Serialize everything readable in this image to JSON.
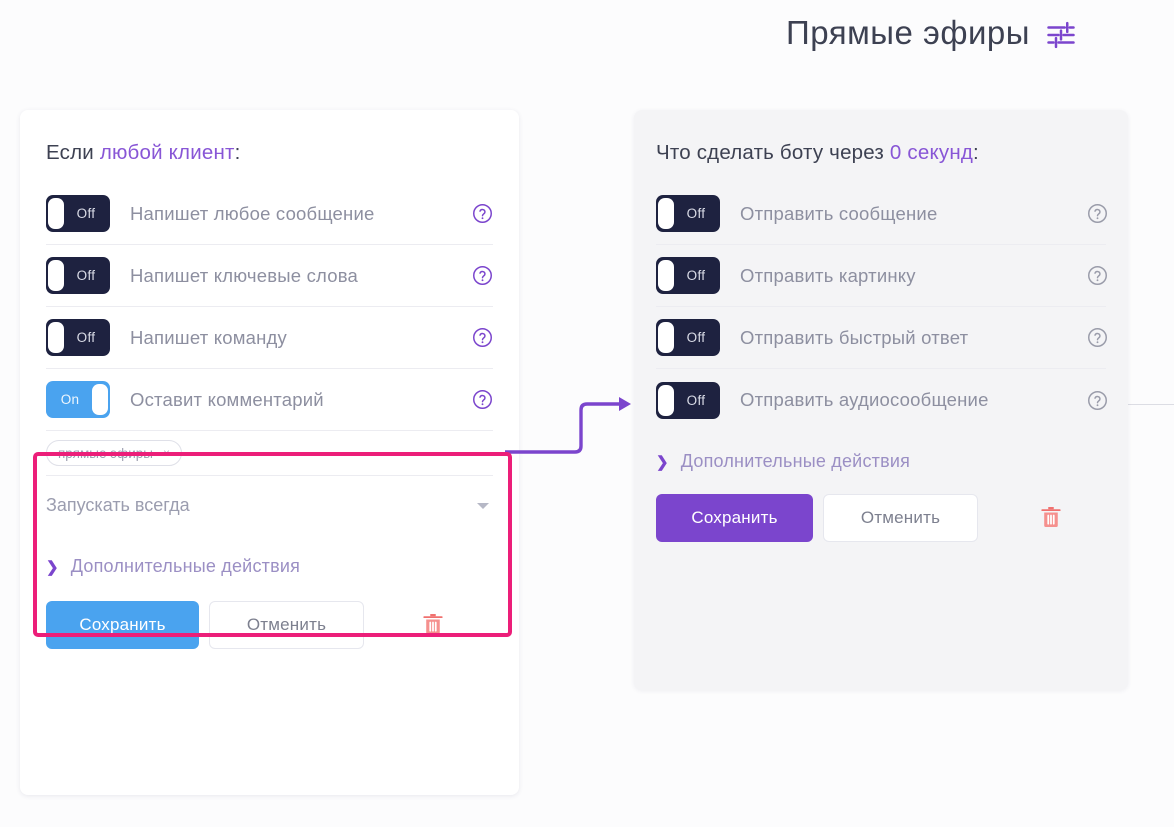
{
  "header": {
    "title": "Прямые эфиры",
    "settings_icon": "sliders-icon"
  },
  "colors": {
    "accent_purple": "#8856d6",
    "save_purple": "#7b45cd",
    "save_blue": "#4aa3ef",
    "toggle_off": "#1e2240",
    "toggle_on": "#4aa3ef",
    "highlight_pink": "#ec1e79",
    "trash_red": "#f0706e",
    "card_right_bg": "#f4f4f6"
  },
  "trigger_card": {
    "title_prefix": "Если ",
    "title_accent": "любой клиент",
    "title_suffix": ":",
    "rows": [
      {
        "toggle_state": "Off",
        "label": "Напишет любое сообщение",
        "help": "?"
      },
      {
        "toggle_state": "Off",
        "label": "Напишет ключевые слова",
        "help": "?"
      },
      {
        "toggle_state": "Off",
        "label": "Напишет команду",
        "help": "?"
      },
      {
        "toggle_state": "On",
        "label": "Оставит комментарий",
        "help": "?"
      }
    ],
    "tag": {
      "label": "прямые эфиры",
      "remove": "×"
    },
    "select": {
      "value": "Запускать всегда"
    },
    "extra_actions": "Дополнительные действия",
    "save_label": "Сохранить",
    "cancel_label": "Отменить",
    "delete_icon": "trash-icon"
  },
  "action_card": {
    "title_prefix": "Что сделать боту через ",
    "title_accent": "0 секунд",
    "title_suffix": ":",
    "rows": [
      {
        "toggle_state": "Off",
        "label": "Отправить сообщение",
        "help": "?"
      },
      {
        "toggle_state": "Off",
        "label": "Отправить картинку",
        "help": "?"
      },
      {
        "toggle_state": "Off",
        "label": "Отправить быстрый ответ",
        "help": "?"
      },
      {
        "toggle_state": "Off",
        "label": "Отправить аудиосообщение",
        "help": "?"
      }
    ],
    "extra_actions": "Дополнительные действия",
    "save_label": "Сохранить",
    "cancel_label": "Отменить",
    "delete_icon": "trash-icon"
  }
}
